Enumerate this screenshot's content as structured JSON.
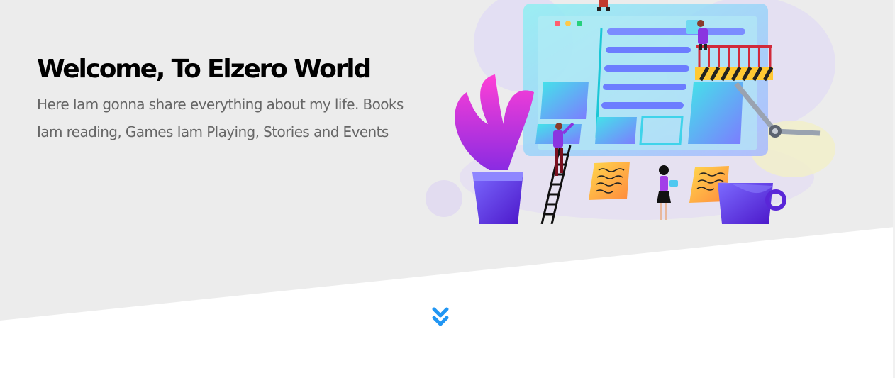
{
  "hero": {
    "title": "Welcome, To Elzero World",
    "subtitle": "Here Iam gonna share everything about my life. Books Iam reading, Games Iam Playing, Stories and Events",
    "background_color": "#ececec",
    "accent_color": "#2196f3"
  },
  "illustration": {
    "name": "website-builders-illustration"
  },
  "scroll_down": {
    "icon": "double-chevron-down-icon"
  }
}
